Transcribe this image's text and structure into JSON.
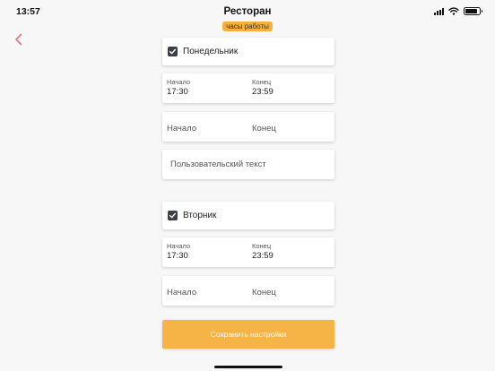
{
  "status_bar": {
    "time": "13:57",
    "icons": [
      "signal-icon",
      "wifi-icon",
      "battery-icon"
    ]
  },
  "header": {
    "title": "Ресторан",
    "subtitle": "часы работы",
    "back_icon": "chevron-left-icon"
  },
  "colors": {
    "accent": "#f7b446",
    "badge": "#f4b13a",
    "back": "#e7707a",
    "checkbox": "#3c3f48"
  },
  "days": [
    {
      "name": "Понедельник",
      "checked": true,
      "interval": {
        "start_label": "Начало",
        "start_value": "17:30",
        "end_label": "Конец",
        "end_value": "23:59"
      },
      "new_interval": {
        "start_placeholder": "Начало",
        "end_placeholder": "Конец"
      },
      "custom_text_placeholder": "Пользовательский текст"
    },
    {
      "name": "Вторник",
      "checked": true,
      "interval": {
        "start_label": "Начало",
        "start_value": "17:30",
        "end_label": "Конец",
        "end_value": "23:59"
      },
      "new_interval": {
        "start_placeholder": "Начало",
        "end_placeholder": "Конец"
      }
    }
  ],
  "save_button": {
    "label": "Сохранить настройки"
  }
}
